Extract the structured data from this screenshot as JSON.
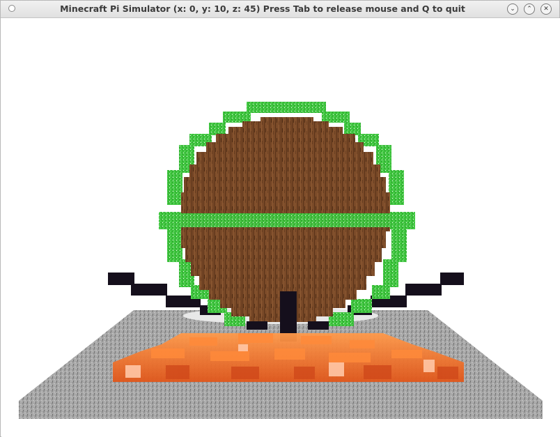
{
  "window": {
    "title": "Minecraft Pi Simulator (x: 0, y: 10, z: 45) Press Tab to release mouse and Q to quit",
    "controls": {
      "close_icon": "circle-close-icon",
      "minimize_glyph": "⌄",
      "maximize_glyph": "⌃",
      "close_glyph": "✕"
    }
  },
  "scene": {
    "palette": {
      "sky": "#ffffff",
      "stone": "#a8a8a8",
      "wood": "#7a4a28",
      "leaves": "#35c035",
      "obsidian": "#150f1c",
      "lava": "#f06a20"
    }
  }
}
